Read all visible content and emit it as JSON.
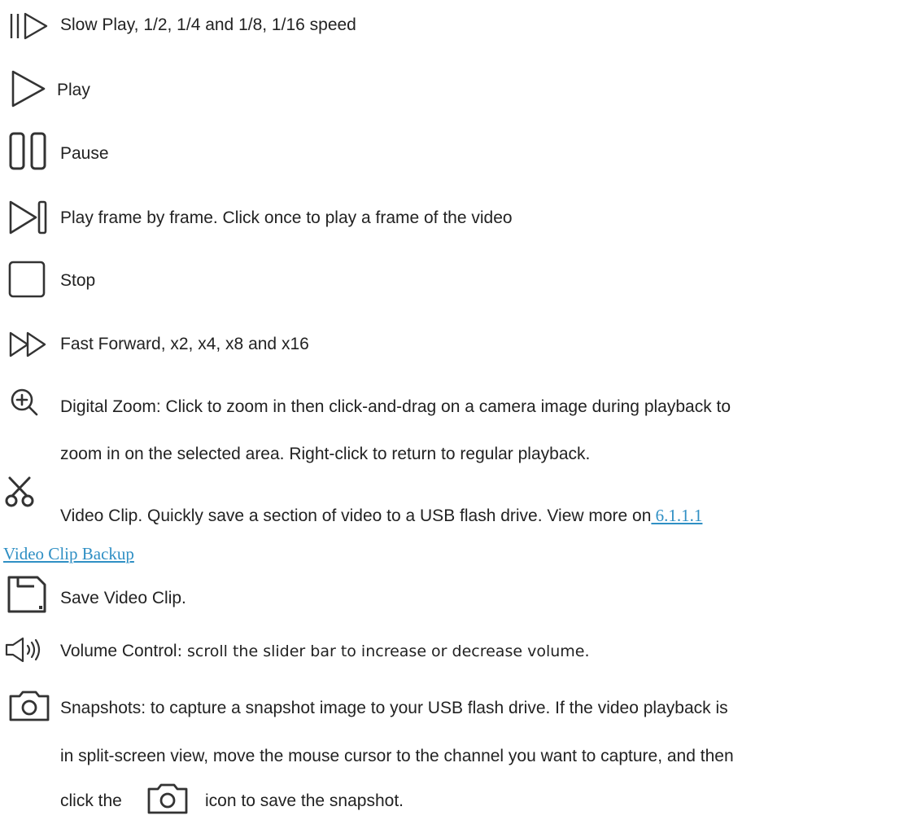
{
  "items": [
    {
      "icon": "slow-play-icon",
      "text": "Slow Play, 1/2, 1/4 and 1/8, 1/16 speed"
    },
    {
      "icon": "play-icon",
      "text": "Play"
    },
    {
      "icon": "pause-icon",
      "text": "Pause"
    },
    {
      "icon": "frame-step-icon",
      "text": "Play frame by frame. Click once to play a frame of the video"
    },
    {
      "icon": "stop-icon",
      "text": "Stop"
    },
    {
      "icon": "fast-forward-icon",
      "text": "Fast Forward, x2, x4, x8 and x16"
    },
    {
      "icon": "zoom-in-icon",
      "line1": "Digital Zoom: Click to zoom in then click-and-drag on a camera image during playback to",
      "line2": "zoom in on the selected area. Right-click to return to regular playback."
    },
    {
      "icon": "scissors-icon",
      "line1": "Video Clip. Quickly save a section of video to a USB flash drive. View more on",
      "link1": " 6.1.1.1",
      "link2": "Video Clip Backup"
    },
    {
      "icon": "save-icon",
      "text": "Save Video Clip."
    },
    {
      "icon": "volume-icon",
      "text_a": "Volume Control",
      "text_b": ": scroll the slider bar to increase or decrease volume."
    },
    {
      "icon": "camera-icon",
      "line1": "Snapshots: to capture a snapshot image to your USB flash drive. If the video playback is",
      "line2": "in split-screen view, move the mouse cursor to the channel you want to capture, and then",
      "line3a": "click the",
      "line3b": "icon to save the snapshot."
    }
  ],
  "colors": {
    "text": "#222222",
    "icon": "#333333",
    "link": "#2f8fc4"
  }
}
